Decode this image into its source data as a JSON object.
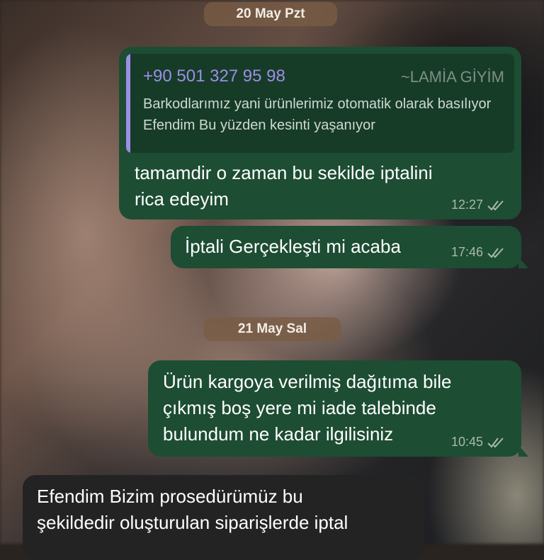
{
  "date_chips": [
    {
      "label": "20 May Pzt"
    },
    {
      "label": "21 May Sal"
    }
  ],
  "messages": [
    {
      "direction": "out",
      "quote": {
        "phone": "+90 501 327 95 98",
        "name": "~LAMİA GİYİM",
        "text": "Barkodlarımız yani ürünlerimiz otomatik olarak basılıyor Efendim Bu yüzden kesinti yaşanıyor"
      },
      "text_lines": [
        "tamamdir o zaman bu sekilde iptalini",
        "rica edeyim"
      ],
      "time": "12:27",
      "status": "read"
    },
    {
      "direction": "out",
      "text_lines": [
        "İptali Gerçekleşti mi acaba"
      ],
      "time": "17:46",
      "status": "read"
    },
    {
      "direction": "out",
      "text_lines": [
        "Ürün kargoya verilmiş dağıtıma bile",
        "çıkmış boş yere mi iade talebinde",
        "bulundum ne kadar ilgilisiniz"
      ],
      "time": "10:45",
      "status": "read"
    },
    {
      "direction": "in",
      "text_lines": [
        "Efendim Bizim prosedürümüz bu",
        "şekildedir oluşturulan siparişlerde iptal"
      ]
    }
  ],
  "colors": {
    "outgoing_bubble": "#1d4d33",
    "incoming_bubble": "#232323",
    "quote_accent": "#9d8ee8",
    "read_ticks": "#a7b9ad"
  }
}
